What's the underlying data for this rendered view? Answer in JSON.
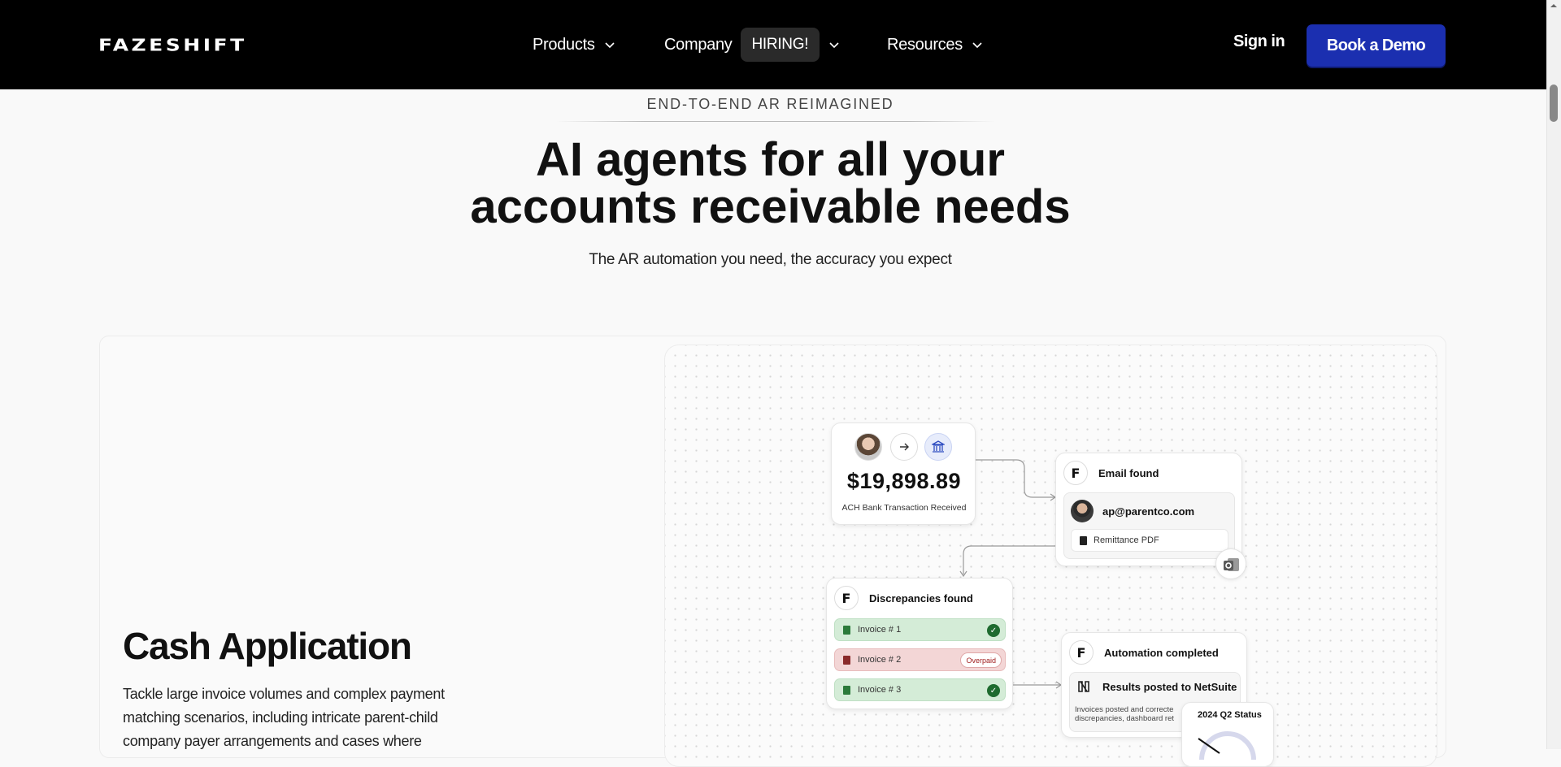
{
  "nav": {
    "logo": "FAZESHIFT",
    "products": "Products",
    "company": "Company",
    "hiring_badge": "HIRING!",
    "resources": "Resources",
    "sign_in": "Sign in",
    "book_demo": "Book a Demo"
  },
  "hero": {
    "eyebrow": "END-TO-END AR REIMAGINED",
    "title_line1": "AI agents for all your",
    "title_line2": "accounts receivable needs",
    "subtitle": "The AR automation you need, the accuracy you expect"
  },
  "feature": {
    "title": "Cash Application",
    "description": "Tackle large invoice volumes and complex payment matching scenarios, including intricate parent-child company payer arrangements and cases where"
  },
  "diagram": {
    "payment": {
      "amount": "$19,898.89",
      "caption": "ACH Bank Transaction Received"
    },
    "email": {
      "title": "Email found",
      "address": "ap@parentco.com",
      "attachment": "Remittance PDF"
    },
    "discrepancies": {
      "title": "Discrepancies found",
      "invoices": [
        {
          "label": "Invoice # 1",
          "status": "ok"
        },
        {
          "label": "Invoice # 2",
          "status": "Overpaid"
        },
        {
          "label": "Invoice # 3",
          "status": "ok"
        }
      ]
    },
    "automation": {
      "title": "Automation completed",
      "result_title": "Results posted to NetSuite",
      "result_line1": "Invoices posted and correcte",
      "result_line2": "discrepancies, dashboard ret"
    },
    "status_card": {
      "title": "2024 Q2 Status"
    }
  }
}
